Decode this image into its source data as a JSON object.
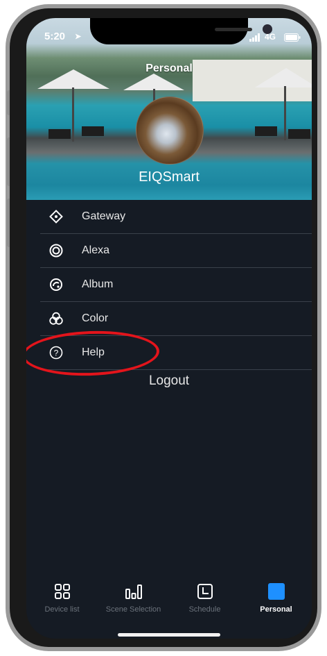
{
  "status_bar": {
    "time": "5:20",
    "network": "4G"
  },
  "header": {
    "title": "Personal",
    "username": "EIQSmart"
  },
  "menu": {
    "items": [
      {
        "label": "Gateway",
        "icon": "gateway-icon"
      },
      {
        "label": "Alexa",
        "icon": "alexa-icon"
      },
      {
        "label": "Album",
        "icon": "album-icon"
      },
      {
        "label": "Color",
        "icon": "color-icon"
      },
      {
        "label": "Help",
        "icon": "help-icon"
      }
    ],
    "logout_label": "Logout"
  },
  "tabbar": {
    "tabs": [
      {
        "label": "Device list",
        "icon": "grid-icon"
      },
      {
        "label": "Scene Selection",
        "icon": "bars-icon"
      },
      {
        "label": "Schedule",
        "icon": "clock-icon"
      },
      {
        "label": "Personal",
        "icon": "personal-icon"
      }
    ],
    "active_index": 3
  },
  "colors": {
    "background": "#151b24",
    "accent": "#1e90ff",
    "highlight_ring": "#e3141b"
  }
}
